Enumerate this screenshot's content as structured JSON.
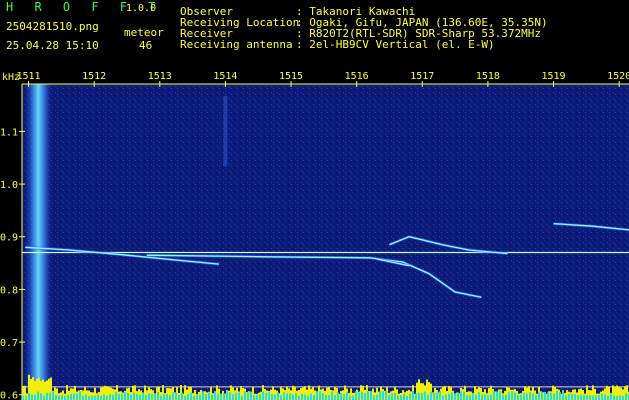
{
  "header": {
    "app_name": "H R O F F T",
    "version": "1.0.0",
    "filename": "2504281510.png",
    "datetime": "25.04.28 15:10",
    "meteor_label": "meteor",
    "meteor_count": "46",
    "rows": [
      {
        "label": "Observer",
        "value": ": Takanori Kawachi"
      },
      {
        "label": "Receiving Location",
        "value": ": Ogaki, Gifu, JAPAN (136.60E, 35.35N)"
      },
      {
        "label": "Receiver",
        "value": ": R820T2(RTL-SDR) SDR-Sharp 53.372MHz"
      },
      {
        "label": "Receiving antenna",
        "value": ": 2el-HB9CV Vertical (el. E-W)"
      }
    ]
  },
  "colors": {
    "background": "#0c1a78",
    "label": "#ffff3c",
    "title": "#33ff33",
    "carrier": "#c8ffff",
    "bar_cyan": "#20e0f0",
    "bar_yellow": "#f0f000"
  },
  "chart_data": {
    "type": "heatmap",
    "ylabel": "kHz",
    "x_ticks": [
      "1511",
      "1512",
      "1513",
      "1514",
      "1515",
      "1516",
      "1517",
      "1518",
      "1519",
      "1520"
    ],
    "x_range": [
      1510.9,
      1520.15
    ],
    "y_ticks": [
      "1.1",
      "1.0",
      "0.9",
      "0.8",
      "0.7",
      "0.6"
    ],
    "y_range": [
      0.59,
      1.19
    ],
    "carrier_khz": 0.87,
    "threshold_khz": 0.615,
    "vertical_band_time": 1511.15,
    "faint_band_time": 1514.0,
    "echoes": [
      {
        "points": [
          [
            1510.95,
            0.88
          ],
          [
            1511.6,
            0.875
          ],
          [
            1512.5,
            0.865
          ],
          [
            1513.3,
            0.855
          ],
          [
            1513.9,
            0.848
          ]
        ]
      },
      {
        "points": [
          [
            1512.8,
            0.865
          ],
          [
            1514.5,
            0.862
          ],
          [
            1516.2,
            0.86
          ],
          [
            1516.7,
            0.852
          ],
          [
            1517.1,
            0.83
          ],
          [
            1517.5,
            0.795
          ],
          [
            1517.9,
            0.785
          ]
        ]
      },
      {
        "points": [
          [
            1516.5,
            0.885
          ],
          [
            1516.8,
            0.9
          ],
          [
            1517.3,
            0.885
          ],
          [
            1517.7,
            0.875
          ],
          [
            1518.3,
            0.868
          ]
        ]
      },
      {
        "points": [
          [
            1519.0,
            0.925
          ],
          [
            1519.6,
            0.92
          ],
          [
            1520.15,
            0.913
          ]
        ]
      },
      {
        "points": [
          [
            1516.3,
            0.858
          ],
          [
            1516.8,
            0.845
          ]
        ]
      }
    ]
  }
}
